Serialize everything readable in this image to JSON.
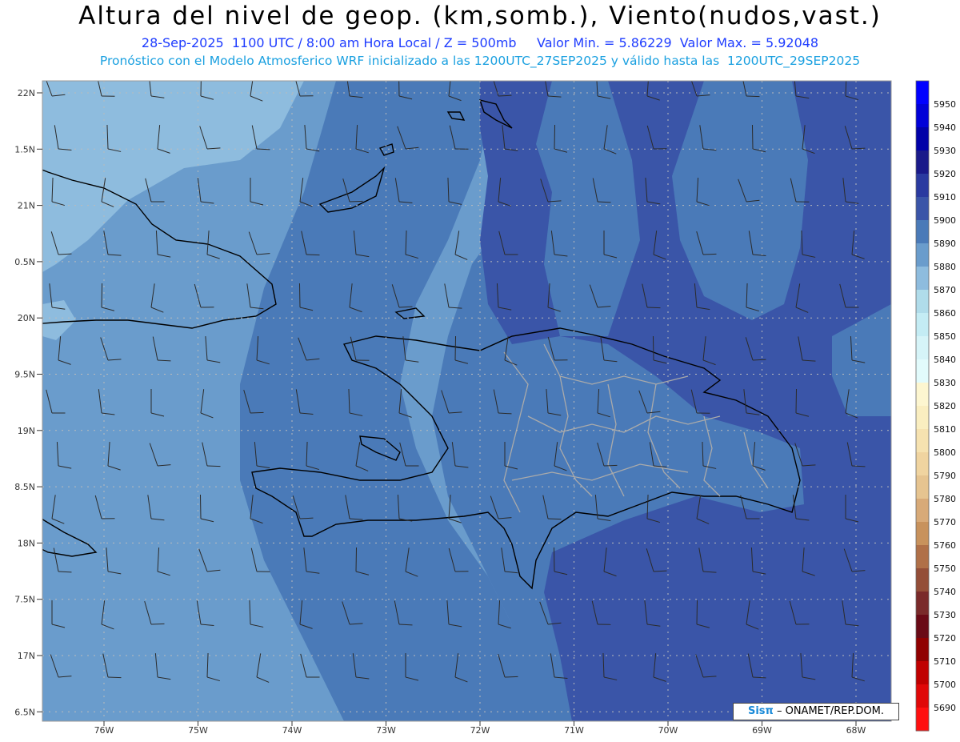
{
  "header": {
    "title": "Altura del nivel de geop. (km,somb.), Viento(nudos,vast.)",
    "line1": "28-Sep-2025  1100 UTC / 8:00 am Hora Local / Z = 500mb     Valor Min. = 5.86229  Valor Max. = 5.92048",
    "line2": "Pronóstico con el Modelo Atmosferico WRF inicializado a las 1200UTC_27SEP2025 y válido hasta las  1200UTC_29SEP2025"
  },
  "axes": {
    "lat_labels": [
      "22N",
      "1.5N",
      "21N",
      "0.5N",
      "20N",
      "9.5N",
      "19N",
      "8.5N",
      "18N",
      "7.5N",
      "17N",
      "6.5N"
    ],
    "lon_labels": [
      "76W",
      "75W",
      "74W",
      "73W",
      "72W",
      "71W",
      "70W",
      "69W",
      "68W"
    ]
  },
  "colorbar": {
    "labels": [
      "5950",
      "5940",
      "5930",
      "5920",
      "5910",
      "5900",
      "5890",
      "5880",
      "5870",
      "5860",
      "5850",
      "5840",
      "5830",
      "5820",
      "5810",
      "5800",
      "5790",
      "5780",
      "5770",
      "5760",
      "5750",
      "5740",
      "5730",
      "5720",
      "5710",
      "5700",
      "5690"
    ],
    "colors": [
      "#0000ff",
      "#0000d8",
      "#0000a8",
      "#1a1a8a",
      "#2a3aa0",
      "#3a55a8",
      "#4a7ab8",
      "#6a9ccc",
      "#8ebcde",
      "#b0dcea",
      "#c4ecf4",
      "#d6f4f8",
      "#e2fbfc",
      "#fdf6d0",
      "#faeec0",
      "#f6e2b0",
      "#f0d4a0",
      "#e6c490",
      "#d8aa78",
      "#c8925c",
      "#b07048",
      "#944e38",
      "#7a2a2a",
      "#6a0a16",
      "#900000",
      "#c00000",
      "#e00808",
      "#ff1010"
    ]
  },
  "shading": {
    "lightest": "#8ebcde",
    "light": "#6a9ccc",
    "mid": "#4a7ab8",
    "dark": "#3a55a8"
  },
  "credit": {
    "brand": "Sisπ",
    "text": "– ONAMET/REP.DOM."
  }
}
